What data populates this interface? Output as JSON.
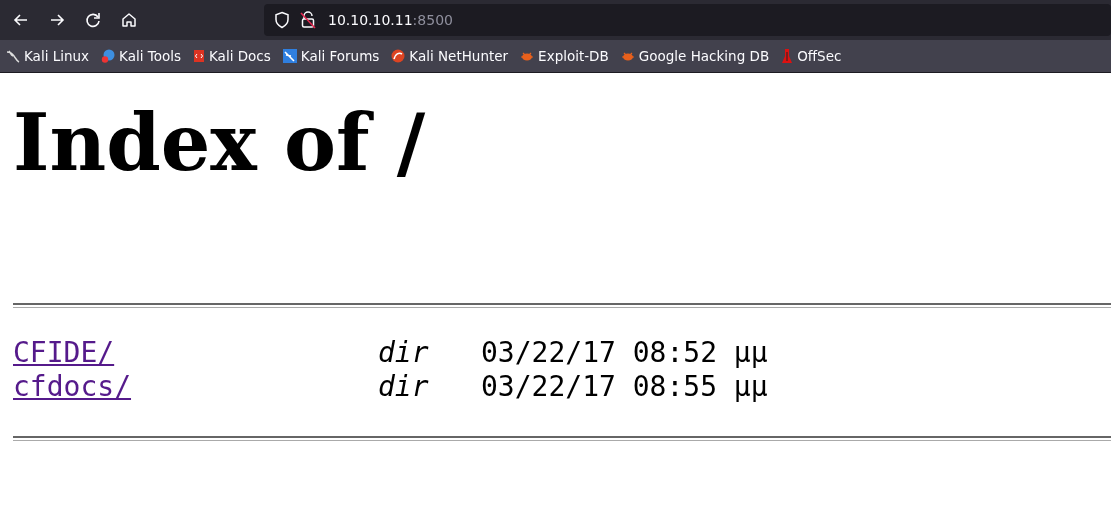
{
  "toolbar": {
    "url": {
      "host": "10.10.10.11",
      "port": ":8500"
    }
  },
  "bookmarks": [
    {
      "label": "Kali Linux"
    },
    {
      "label": "Kali Tools"
    },
    {
      "label": "Kali Docs"
    },
    {
      "label": "Kali Forums"
    },
    {
      "label": "Kali NetHunter"
    },
    {
      "label": "Exploit-DB"
    },
    {
      "label": "Google Hacking DB"
    },
    {
      "label": "OffSec"
    }
  ],
  "page": {
    "heading": "Index of /",
    "entries": [
      {
        "name": "CFIDE/",
        "type": "dir",
        "date": "03/22/17 08:52 μμ"
      },
      {
        "name": "cfdocs/",
        "type": "dir",
        "date": "03/22/17 08:55 μμ"
      }
    ]
  }
}
